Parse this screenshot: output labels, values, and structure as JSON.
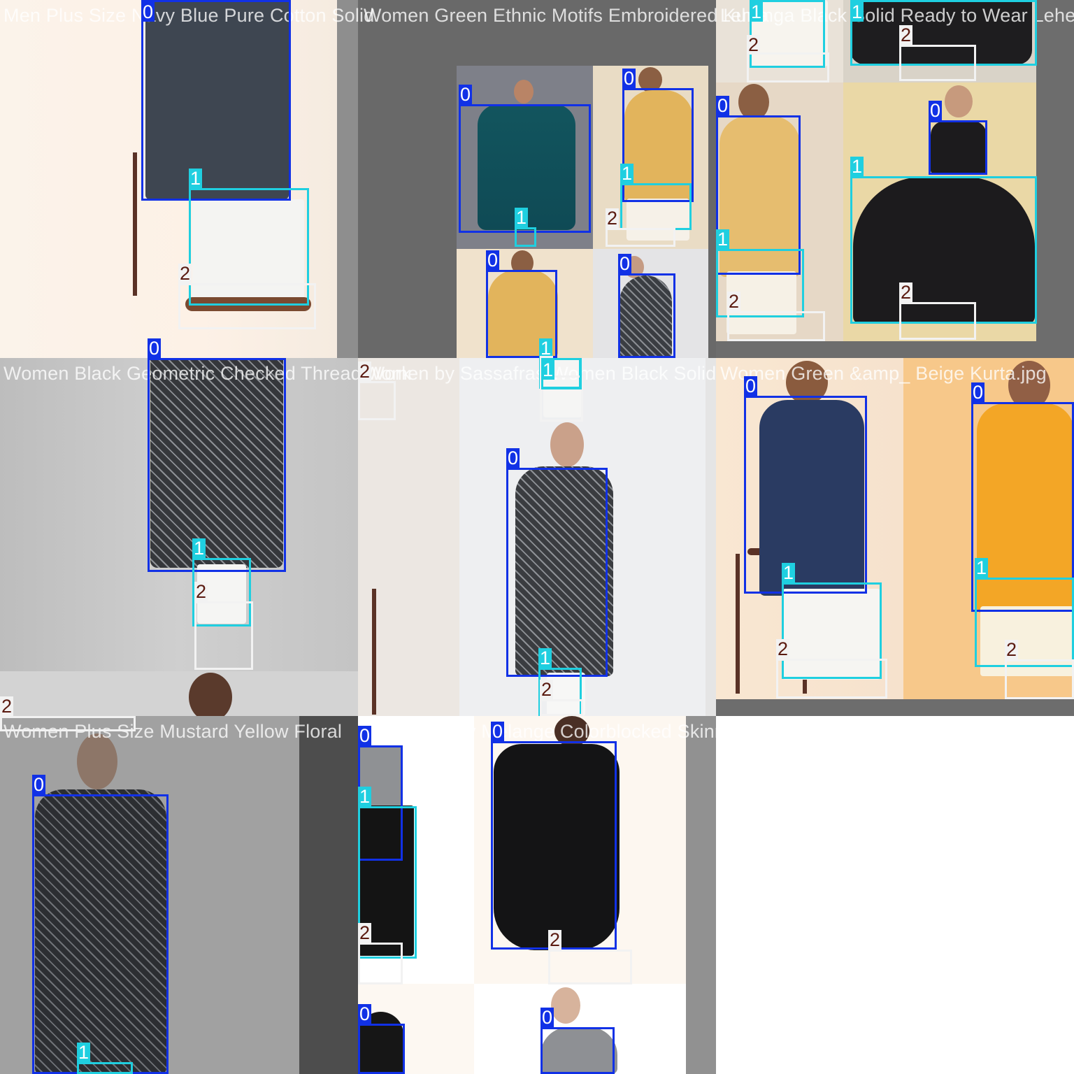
{
  "classes": [
    {
      "id": "0",
      "color": "#1131e6",
      "text_color": "#ffffff"
    },
    {
      "id": "1",
      "color": "#1fcfe0",
      "text_color": "#ffffff"
    },
    {
      "id": "2",
      "color": "#f2f2f2",
      "text_color": "#5a1a10"
    }
  ],
  "tiles": [
    {
      "name": "tile-1",
      "caption": "Men Plus Size Navy Blue Pure Cotton Solid"
    },
    {
      "name": "tile-2",
      "caption": "Women Green Ethnic Motifs Embroidered Kurta"
    },
    {
      "name": "tile-3",
      "caption": "Lehenga Black Solid Ready to Wear Lehenga"
    },
    {
      "name": "tile-4",
      "caption": "Women Black Geometric Checked Thread Work"
    },
    {
      "name": "tile-5",
      "caption": "Women by Sassafras Women Black Solid"
    },
    {
      "name": "tile-6",
      "caption": "Women Green &amp_ Beige Kurta.jpg"
    },
    {
      "name": "tile-7",
      "caption": "Women Plus Size Mustard Yellow Floral"
    },
    {
      "name": "tile-8",
      "caption": "Women Grey Melange Colorblocked Skinny F"
    }
  ],
  "detections": [
    {
      "tile": 0,
      "cls": "0",
      "label": "0"
    },
    {
      "tile": 0,
      "cls": "1",
      "label": "1"
    },
    {
      "tile": 0,
      "cls": "2",
      "label": "2"
    },
    {
      "tile": 1,
      "cls": "0",
      "label": "0"
    },
    {
      "tile": 1,
      "cls": "0",
      "label": "0"
    },
    {
      "tile": 1,
      "cls": "1",
      "label": "1"
    },
    {
      "tile": 1,
      "cls": "1",
      "label": "1"
    },
    {
      "tile": 1,
      "cls": "2",
      "label": "2"
    },
    {
      "tile": 1,
      "cls": "0",
      "label": "0"
    },
    {
      "tile": 1,
      "cls": "0",
      "label": "0"
    },
    {
      "tile": 1,
      "cls": "1",
      "label": "1"
    },
    {
      "tile": 2,
      "cls": "1",
      "label": "1"
    },
    {
      "tile": 2,
      "cls": "2",
      "label": "2"
    },
    {
      "tile": 2,
      "cls": "1",
      "label": "1"
    },
    {
      "tile": 2,
      "cls": "2",
      "label": "2"
    },
    {
      "tile": 2,
      "cls": "0",
      "label": "0"
    },
    {
      "tile": 2,
      "cls": "0",
      "label": "0"
    },
    {
      "tile": 2,
      "cls": "1",
      "label": "1"
    },
    {
      "tile": 2,
      "cls": "1",
      "label": "1"
    },
    {
      "tile": 2,
      "cls": "2",
      "label": "2"
    },
    {
      "tile": 2,
      "cls": "2",
      "label": "2"
    },
    {
      "tile": 3,
      "cls": "0",
      "label": "0"
    },
    {
      "tile": 3,
      "cls": "1",
      "label": "1"
    },
    {
      "tile": 3,
      "cls": "2",
      "label": "2"
    },
    {
      "tile": 3,
      "cls": "2",
      "label": "2"
    },
    {
      "tile": 4,
      "cls": "2",
      "label": "2"
    },
    {
      "tile": 4,
      "cls": "2",
      "label": "2"
    },
    {
      "tile": 4,
      "cls": "1",
      "label": "1"
    },
    {
      "tile": 4,
      "cls": "0",
      "label": "0"
    },
    {
      "tile": 4,
      "cls": "1",
      "label": "1"
    },
    {
      "tile": 4,
      "cls": "2",
      "label": "2"
    },
    {
      "tile": 5,
      "cls": "0",
      "label": "0"
    },
    {
      "tile": 5,
      "cls": "1",
      "label": "1"
    },
    {
      "tile": 5,
      "cls": "2",
      "label": "2"
    },
    {
      "tile": 5,
      "cls": "0",
      "label": "0"
    },
    {
      "tile": 5,
      "cls": "1",
      "label": "1"
    },
    {
      "tile": 5,
      "cls": "2",
      "label": "2"
    },
    {
      "tile": 6,
      "cls": "0",
      "label": "0"
    },
    {
      "tile": 6,
      "cls": "1",
      "label": "1"
    },
    {
      "tile": 7,
      "cls": "0",
      "label": "0"
    },
    {
      "tile": 7,
      "cls": "1",
      "label": "1"
    },
    {
      "tile": 7,
      "cls": "2",
      "label": "2"
    },
    {
      "tile": 7,
      "cls": "0",
      "label": "0"
    },
    {
      "tile": 7,
      "cls": "2",
      "label": "2"
    },
    {
      "tile": 7,
      "cls": "0",
      "label": "0"
    },
    {
      "tile": 7,
      "cls": "0",
      "label": "0"
    }
  ]
}
